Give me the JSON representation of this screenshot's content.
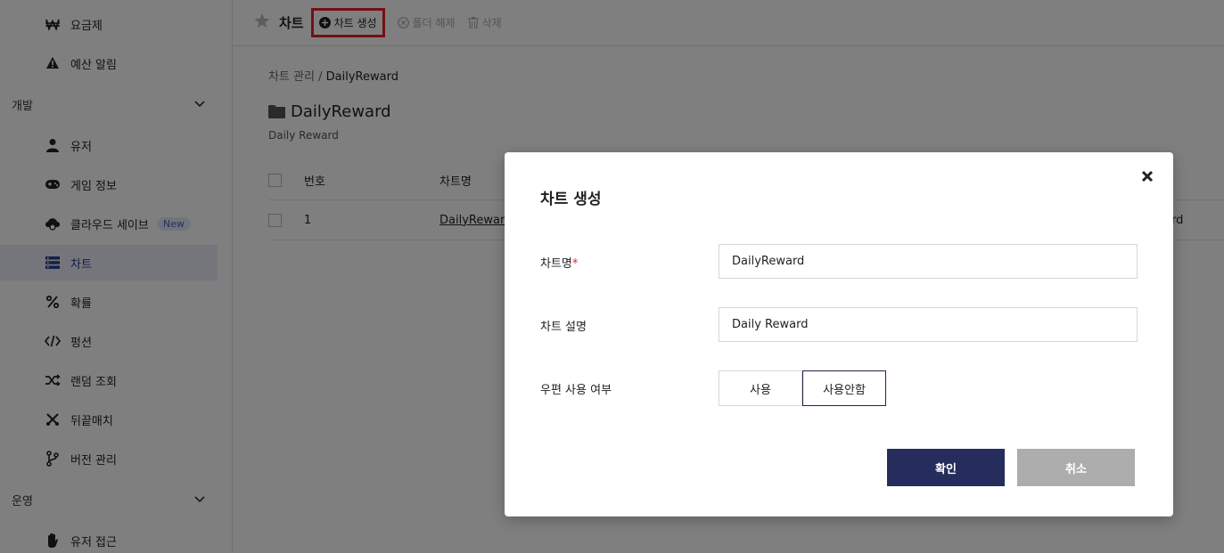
{
  "sidebar": {
    "items": [
      {
        "label": "요금제",
        "icon": "won-icon"
      },
      {
        "label": "예산 알림",
        "icon": "warning-icon"
      },
      {
        "label": "유저",
        "icon": "user-icon"
      },
      {
        "label": "게임 정보",
        "icon": "gamepad-icon"
      },
      {
        "label": "클라우드 세이브",
        "icon": "cloud-save-icon",
        "badge": "New"
      },
      {
        "label": "차트",
        "icon": "chart-list-icon",
        "active": true
      },
      {
        "label": "확률",
        "icon": "percent-icon"
      },
      {
        "label": "펑션",
        "icon": "code-icon"
      },
      {
        "label": "랜덤 조회",
        "icon": "shuffle-icon"
      },
      {
        "label": "뒤끝매치",
        "icon": "match-icon"
      },
      {
        "label": "버전 관리",
        "icon": "branch-icon"
      },
      {
        "label": "유저 접근",
        "icon": "hand-icon"
      }
    ],
    "sections": [
      {
        "label": "개발"
      },
      {
        "label": "운영"
      }
    ]
  },
  "topbar": {
    "title": "차트",
    "create_label": "차트 생성",
    "unfolder_label": "폴더 해제",
    "delete_label": "삭제"
  },
  "breadcrumb": {
    "root": "차트 관리",
    "separator": " / ",
    "current": "DailyReward"
  },
  "folder": {
    "title": "DailyReward",
    "description": "Daily Reward"
  },
  "table": {
    "headers": {
      "number": "번호",
      "chart_name": "차트명"
    },
    "rows": [
      {
        "number": "1",
        "chart_name": "DailyReward",
        "trailing": "rd"
      }
    ]
  },
  "modal": {
    "title": "차트 생성",
    "name_label": "차트명",
    "required_mark": "*",
    "name_value": "DailyReward",
    "desc_label": "차트 설명",
    "desc_value": "Daily Reward",
    "mail_label": "우편 사용 여부",
    "mail_options": [
      "사용",
      "사용안함"
    ],
    "mail_selected": "사용안함",
    "ok_label": "확인",
    "cancel_label": "취소"
  },
  "colors": {
    "accent": "#262d5c",
    "active_nav": "#2b3c8f",
    "highlight_border": "#e5202a",
    "required": "#e02828"
  }
}
